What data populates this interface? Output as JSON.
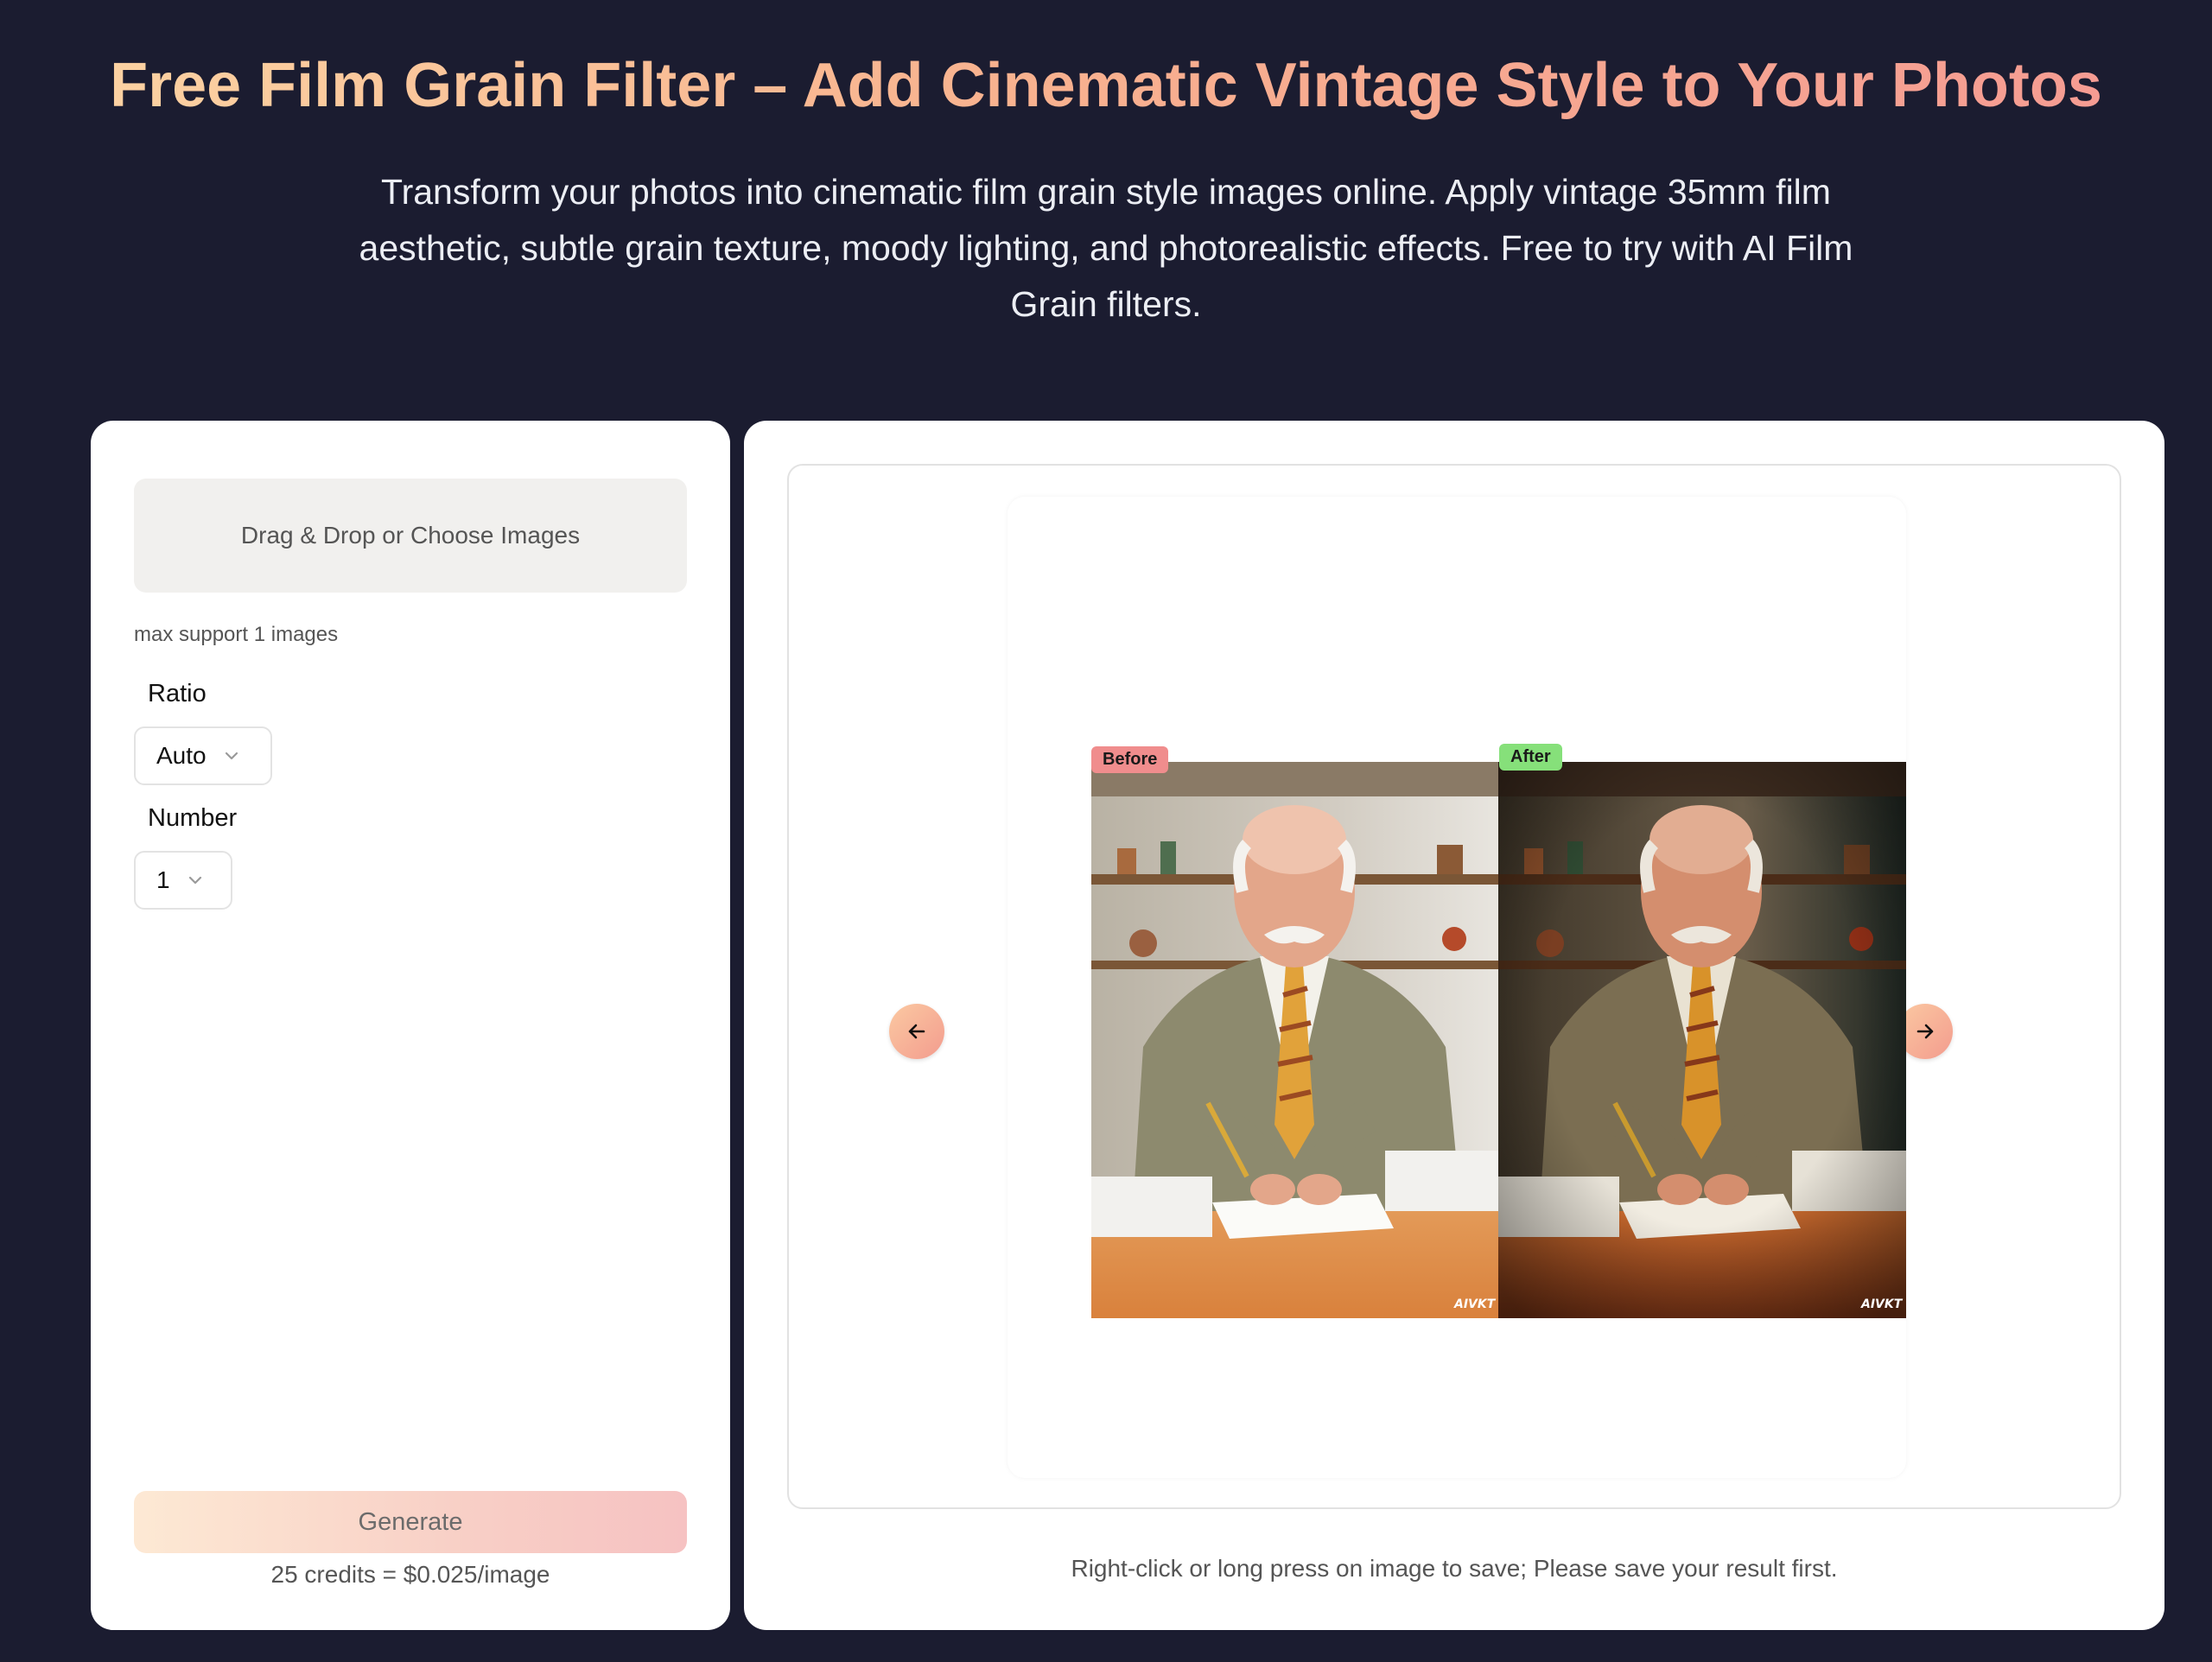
{
  "hero": {
    "title": "Free Film Grain Filter – Add Cinematic Vintage Style to Your Photos",
    "description": "Transform your photos into cinematic film grain style images online. Apply vintage 35mm film aesthetic, subtle grain texture, moody lighting, and photorealistic effects. Free to try with AI Film Grain filters."
  },
  "upload": {
    "dropzone_label": "Drag & Drop or Choose Images",
    "hint": "max support 1 images"
  },
  "options": {
    "ratio_label": "Ratio",
    "ratio_value": "Auto",
    "number_label": "Number",
    "number_value": "1"
  },
  "actions": {
    "generate_label": "Generate",
    "credits_text": "25 credits = $0.025/image"
  },
  "preview": {
    "before_label": "Before",
    "after_label": "After",
    "watermark": "AIVKT",
    "save_note": "Right-click or long press on image to save; Please save your result first."
  },
  "colors": {
    "page_bg": "#1b1c30",
    "before_badge": "#f08d8d",
    "after_badge": "#86e07a",
    "accent_start": "#fcd5a4",
    "accent_end": "#f59a93"
  }
}
